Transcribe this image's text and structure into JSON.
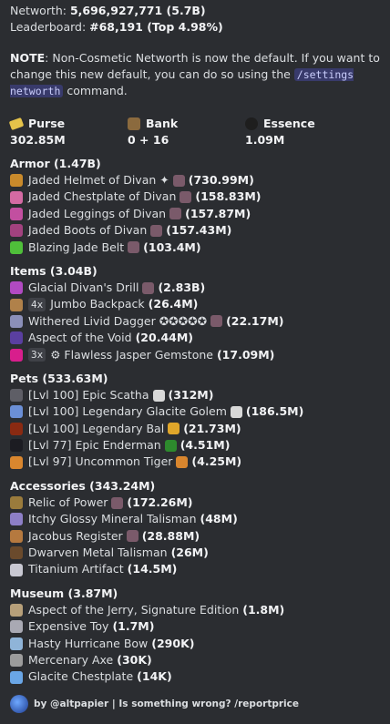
{
  "header": {
    "networth_label": "Networth: ",
    "networth_value": "5,696,927,771 (5.7B)",
    "leaderboard_label": "Leaderboard: ",
    "leaderboard_value": "#68,191 (Top 4.98%)"
  },
  "note": {
    "label": "NOTE",
    "text": ": Non-Cosmetic Networth is now the default. If you want to change this new default, you can do so using the ",
    "command": "/settings networth",
    "after": " command."
  },
  "stats": [
    {
      "label": "Purse",
      "value": "302.85M",
      "icon": "gold-coin-icon",
      "color": "#e5c34a"
    },
    {
      "label": "Bank",
      "value": "0 + 16",
      "icon": "bank-chest-icon",
      "color": "#8b6a3e"
    },
    {
      "label": "Essence",
      "value": "1.09M",
      "icon": "essence-icon",
      "color": "#2c2c2c"
    }
  ],
  "sections": [
    {
      "title": "Armor (1.47B)",
      "items": [
        {
          "name": "Jaded Helmet of Divan ✦",
          "value": "(730.99M)",
          "icon": "helmet-icon",
          "color": "#c98a2b",
          "badge": "",
          "extra": "gemstone-icon"
        },
        {
          "name": "Jaded Chestplate of Divan",
          "value": "(158.83M)",
          "icon": "chestplate-icon",
          "color": "#d46aa3",
          "badge": "",
          "extra": "gemstone-icon"
        },
        {
          "name": "Jaded Leggings of Divan",
          "value": "(157.87M)",
          "icon": "leggings-icon",
          "color": "#c24fa0",
          "badge": "",
          "extra": "gemstone-icon"
        },
        {
          "name": "Jaded Boots of Divan",
          "value": "(157.43M)",
          "icon": "boots-icon",
          "color": "#a2427f",
          "badge": "",
          "extra": "gemstone-icon"
        },
        {
          "name": "Blazing Jade Belt",
          "value": "(103.4M)",
          "icon": "jade-belt-icon",
          "color": "#4fbf3a",
          "badge": "",
          "extra": "gemstone-icon"
        }
      ]
    },
    {
      "title": "Items (3.04B)",
      "items": [
        {
          "name": "Glacial Divan's Drill",
          "value": "(2.83B)",
          "icon": "drill-icon",
          "color": "#b14ac2",
          "badge": "",
          "extra": "gemstone-icon"
        },
        {
          "name": "Jumbo Backpack",
          "value": "(26.4M)",
          "icon": "backpack-icon",
          "color": "#b0814a",
          "badge": "4x",
          "extra": ""
        },
        {
          "name": "Withered Livid Dagger ✪✪✪✪✪",
          "value": "(22.17M)",
          "icon": "dagger-icon",
          "color": "#8b8fb8",
          "badge": "",
          "extra": "gemstone-icon"
        },
        {
          "name": "Aspect of the Void",
          "value": "(20.44M)",
          "icon": "void-sword-icon",
          "color": "#5a3fa0",
          "badge": "",
          "extra": ""
        },
        {
          "name": "⚙ Flawless Jasper Gemstone",
          "value": "(17.09M)",
          "icon": "jasper-gemstone-icon",
          "color": "#d81e8c",
          "badge": "3x",
          "extra": ""
        }
      ]
    },
    {
      "title": "Pets (533.63M)",
      "items": [
        {
          "name": "[Lvl 100] Epic Scatha",
          "value": "(312M)",
          "icon": "scatha-icon",
          "color": "#5e5e66",
          "badge": "",
          "extra": "pet-item-icon"
        },
        {
          "name": "[Lvl 100] Legendary Glacite Golem",
          "value": "(186.5M)",
          "icon": "golem-icon",
          "color": "#6b8fd6",
          "badge": "",
          "extra": "pet-item-icon"
        },
        {
          "name": "[Lvl 100] Legendary Bal",
          "value": "(21.73M)",
          "icon": "bal-icon",
          "color": "#8a2a12",
          "badge": "",
          "extra": "pet-item-gold-icon"
        },
        {
          "name": "[Lvl 77] Epic Enderman",
          "value": "(4.51M)",
          "icon": "enderman-icon",
          "color": "#1c1c22",
          "badge": "",
          "extra": "pet-item-green-icon"
        },
        {
          "name": "[Lvl 97] Uncommon Tiger",
          "value": "(4.25M)",
          "icon": "tiger-icon",
          "color": "#d9862e",
          "badge": "",
          "extra": "pet-item-orange-icon"
        }
      ]
    },
    {
      "title": "Accessories (343.24M)",
      "items": [
        {
          "name": "Relic of Power",
          "value": "(172.26M)",
          "icon": "relic-icon",
          "color": "#9a7b3c",
          "badge": "",
          "extra": "gemstone-icon"
        },
        {
          "name": "Itchy Glossy Mineral Talisman",
          "value": "(48M)",
          "icon": "mineral-talisman-icon",
          "color": "#8d7fc7",
          "badge": "",
          "extra": ""
        },
        {
          "name": "Jacobus Register",
          "value": "(28.88M)",
          "icon": "register-icon",
          "color": "#b5793f",
          "badge": "",
          "extra": "gemstone-icon"
        },
        {
          "name": "Dwarven Metal Talisman",
          "value": "(26M)",
          "icon": "metal-talisman-icon",
          "color": "#6a4a2c",
          "badge": "",
          "extra": ""
        },
        {
          "name": "Titanium Artifact",
          "value": "(14.5M)",
          "icon": "titanium-icon",
          "color": "#c8c8d2",
          "badge": "",
          "extra": ""
        }
      ]
    },
    {
      "title": "Museum (3.87M)",
      "items": [
        {
          "name": "Aspect of the Jerry, Signature Edition",
          "value": "(1.8M)",
          "icon": "jerry-sword-icon",
          "color": "#b7a07a",
          "badge": "",
          "extra": ""
        },
        {
          "name": "Expensive Toy",
          "value": "(1.7M)",
          "icon": "toy-icon",
          "color": "#a9a9b3",
          "badge": "",
          "extra": ""
        },
        {
          "name": "Hasty Hurricane Bow",
          "value": "(290K)",
          "icon": "bow-icon",
          "color": "#8fb4d8",
          "badge": "",
          "extra": ""
        },
        {
          "name": "Mercenary Axe",
          "value": "(30K)",
          "icon": "axe-icon",
          "color": "#9c9c9c",
          "badge": "",
          "extra": ""
        },
        {
          "name": "Glacite Chestplate",
          "value": "(14K)",
          "icon": "glacite-chestplate-icon",
          "color": "#6aa6e6",
          "badge": "",
          "extra": ""
        }
      ]
    }
  ],
  "footer": {
    "text": "by @altpapier | Is something wrong? /reportprice",
    "icon": "bot-avatar-icon"
  }
}
